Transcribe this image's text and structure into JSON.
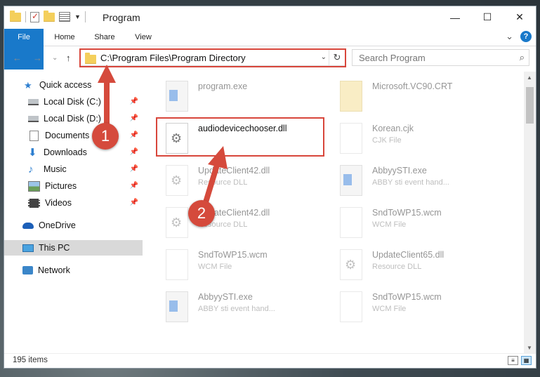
{
  "window": {
    "title": "Program"
  },
  "caption": {
    "minimize": "—",
    "maximize": "☐",
    "close": "✕"
  },
  "ribbon": {
    "tabs": [
      "File",
      "Home",
      "Share",
      "View"
    ],
    "expand": "⌄",
    "help": "?"
  },
  "address": {
    "path": "C:\\Program Files\\Program Directory",
    "refresh": "↻",
    "dropdown": "⌄"
  },
  "nav_buttons": {
    "back": "←",
    "forward": "→",
    "recent": "⌄",
    "up": "↑"
  },
  "search": {
    "placeholder": "Search Program",
    "icon": "⌕"
  },
  "sidebar": {
    "items": [
      {
        "label": "Quick access",
        "icon": "star-icon"
      },
      {
        "label": "Local Disk (C:)",
        "icon": "drive-icon"
      },
      {
        "label": "Local Disk (D:)",
        "icon": "drive-icon"
      },
      {
        "label": "Documents",
        "icon": "documents-icon"
      },
      {
        "label": "Downloads",
        "icon": "downloads-icon"
      },
      {
        "label": "Music",
        "icon": "music-icon"
      },
      {
        "label": "Pictures",
        "icon": "pictures-icon"
      },
      {
        "label": "Videos",
        "icon": "videos-icon"
      },
      {
        "label": "OneDrive",
        "icon": "onedrive-icon"
      },
      {
        "label": "This PC",
        "icon": "pc-icon"
      },
      {
        "label": "Network",
        "icon": "network-icon"
      }
    ]
  },
  "files": [
    {
      "name": "program.exe",
      "type": "",
      "icon": "exe"
    },
    {
      "name": "Microsoft.VC90.CRT",
      "type": "",
      "icon": "folder"
    },
    {
      "name": "audiodevicechooser.dll",
      "type": "",
      "icon": "gear"
    },
    {
      "name": "Korean.cjk",
      "type": "CJK File",
      "icon": "blank"
    },
    {
      "name": "UpdateClient42.dll",
      "type": "Resource DLL",
      "icon": "gear"
    },
    {
      "name": "AbbyySTI.exe",
      "type": "ABBY sti event hand...",
      "icon": "exe"
    },
    {
      "name": "UpdateClient42.dll",
      "type": "Resource DLL",
      "icon": "gear"
    },
    {
      "name": "SndToWP15.wcm",
      "type": "WCM File",
      "icon": "blank"
    },
    {
      "name": "SndToWP15.wcm",
      "type": "WCM File",
      "icon": "blank"
    },
    {
      "name": "UpdateClient65.dll",
      "type": "Resource DLL",
      "icon": "gear"
    },
    {
      "name": "AbbyySTI.exe",
      "type": "ABBY sti event hand...",
      "icon": "exe"
    },
    {
      "name": "SndToWP15.wcm",
      "type": "WCM File",
      "icon": "blank"
    }
  ],
  "status": {
    "items": "195 items"
  },
  "annotations": {
    "step1": "1",
    "step2": "2",
    "color": "#d54a3c"
  }
}
